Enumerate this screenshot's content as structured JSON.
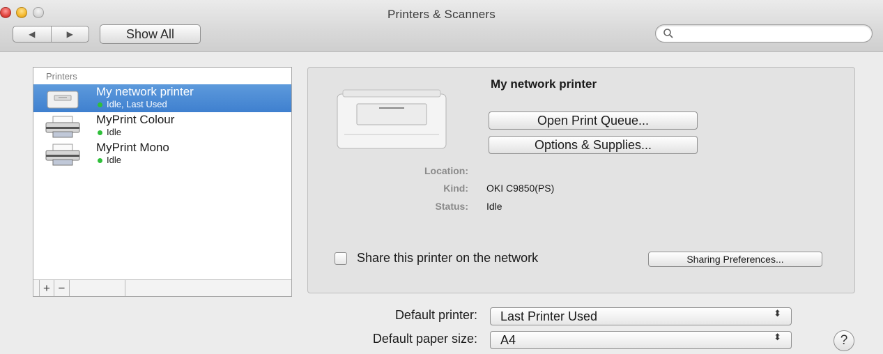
{
  "window": {
    "title": "Printers & Scanners",
    "back_icon": "◀",
    "forward_icon": "▶",
    "show_all_label": "Show All",
    "search_placeholder": ""
  },
  "printers": {
    "header": "Printers",
    "items": [
      {
        "name": "My network printer",
        "status": "Idle, Last Used",
        "selected": true,
        "icon": "laser-printer-icon"
      },
      {
        "name": "MyPrint Colour",
        "status": "Idle",
        "selected": false,
        "icon": "printer-icon"
      },
      {
        "name": "MyPrint Mono",
        "status": "Idle",
        "selected": false,
        "icon": "printer-icon"
      }
    ],
    "add_label": "+",
    "remove_label": "−"
  },
  "detail": {
    "printer_name": "My network printer",
    "open_queue_label": "Open Print Queue...",
    "options_supplies_label": "Options & Supplies...",
    "location_label": "Location:",
    "location_value": "",
    "kind_label": "Kind:",
    "kind_value": "OKI C9850(PS)",
    "status_label": "Status:",
    "status_value": "Idle",
    "share_label": "Share this printer on the network",
    "share_checked": false,
    "sharing_prefs_label": "Sharing Preferences..."
  },
  "defaults": {
    "default_printer_label": "Default printer:",
    "default_printer_value": "Last Printer Used",
    "default_paper_label": "Default paper size:",
    "default_paper_value": "A4",
    "popup_arrows": "⬍"
  },
  "help_label": "?",
  "colors": {
    "selection": "#3f80cf",
    "status_dot": "#2fbf3a"
  }
}
